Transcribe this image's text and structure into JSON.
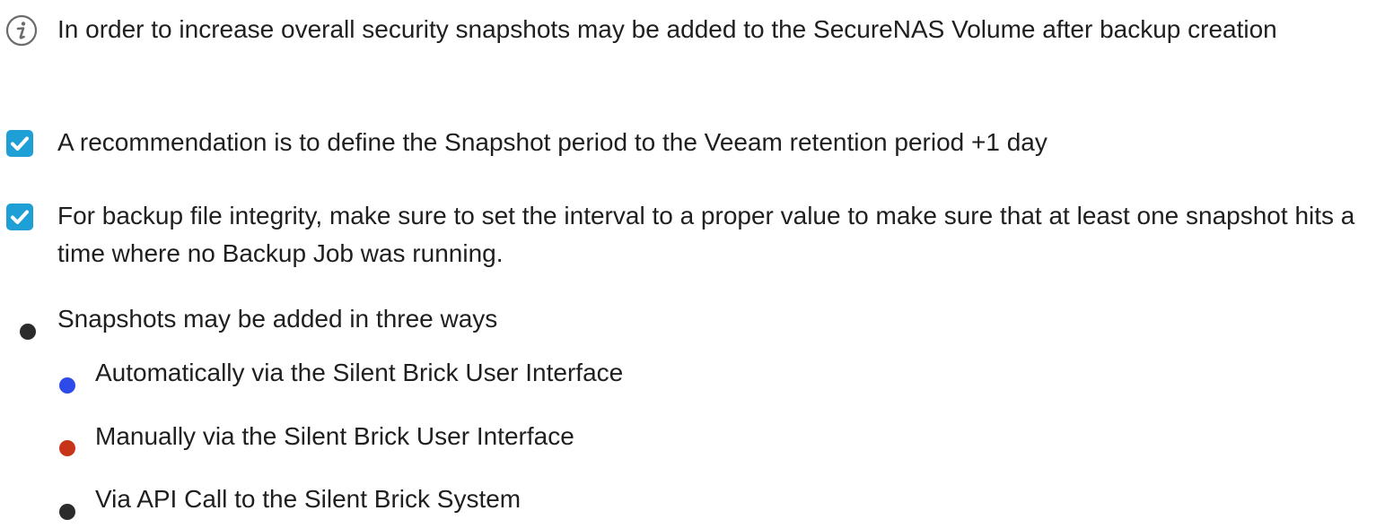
{
  "items": {
    "info": {
      "text": "In order to increase overall security snapshots may be added to the SecureNAS Volume after backup creation",
      "icon": "info-icon"
    },
    "check1": {
      "text": "A recommendation is to define the Snapshot period to the Veeam retention period +1 day",
      "icon": "checkbox-checked-icon"
    },
    "check2": {
      "text": "For backup file integrity, make sure to set the interval to a proper value to make sure that at least one snapshot hits a time where no Backup Job was running.",
      "icon": "checkbox-checked-icon"
    },
    "bullet": {
      "text": "Snapshots may be added in three ways",
      "sub": [
        {
          "text": "Automatically via the Silent Brick User Interface",
          "color": "#2d4be8"
        },
        {
          "text": "Manually via the Silent Brick User Interface",
          "color": "#c8341a"
        },
        {
          "text": "Via API Call to the Silent Brick System",
          "color": "#2b2b2b"
        }
      ]
    }
  },
  "colors": {
    "checkbox": "#1e9fd6",
    "info_icon": "#6b6b6b",
    "text": "#1f1f1f",
    "bullet_main": "#2b2b2b"
  }
}
